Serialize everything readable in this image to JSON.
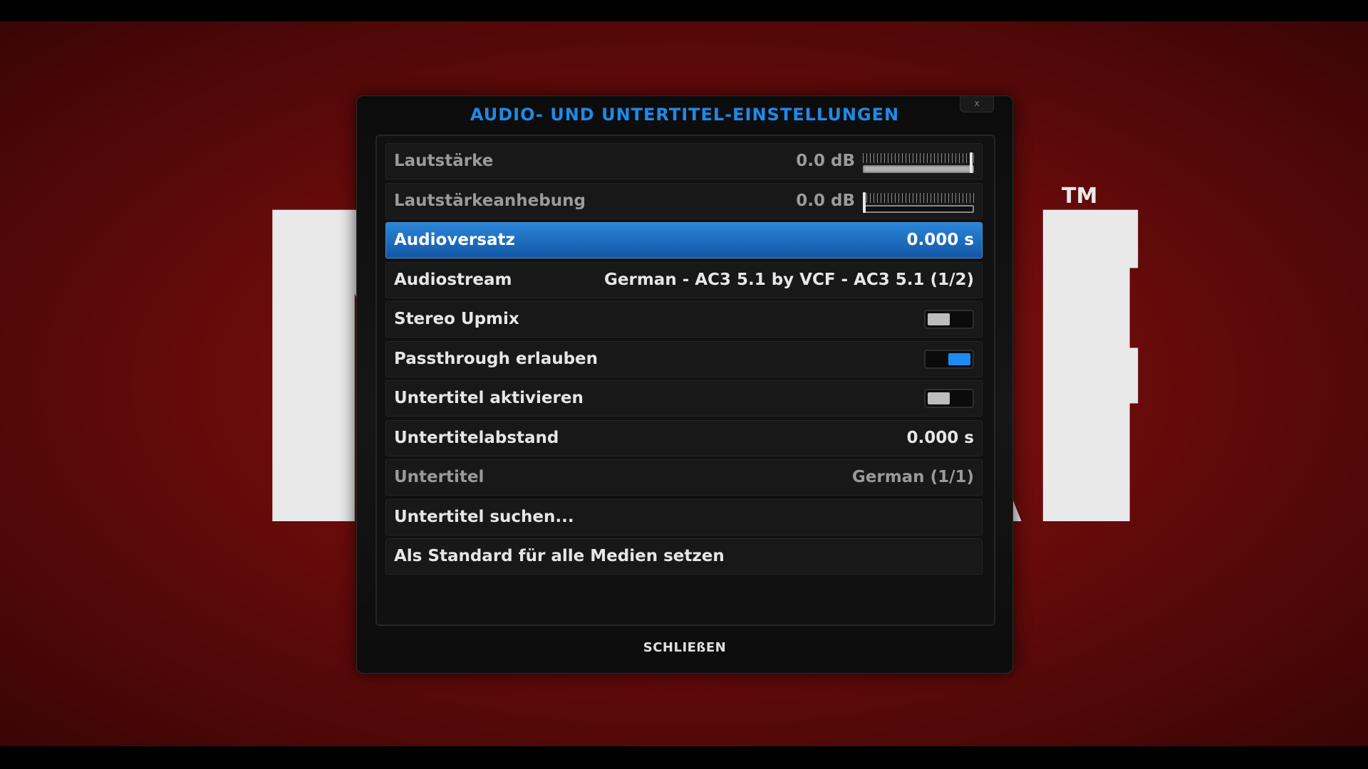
{
  "background": {
    "logo_text": "MARVEL",
    "trademark": "TM"
  },
  "dialog": {
    "title": "AUDIO- UND UNTERTITEL-EINSTELLUNGEN",
    "close_label": "x",
    "footer_button": "SCHLIEßEN",
    "accent_color": "#1f8ae6",
    "focus_color": "#1f6fc4"
  },
  "settings": [
    {
      "label": "Lautstärke",
      "value": "0.0 dB",
      "control": "slider",
      "level": 1.0,
      "state": "dim"
    },
    {
      "label": "Lautstärkeanhebung",
      "value": "0.0 dB",
      "control": "slider",
      "level": 0.0,
      "state": "dim"
    },
    {
      "label": "Audioversatz",
      "value": "0.000 s",
      "control": "value",
      "state": "focused"
    },
    {
      "label": "Audiostream",
      "value": "German - AC3 5.1 by VCF - AC3 5.1 (1/2)",
      "control": "value",
      "state": "normal"
    },
    {
      "label": "Stereo Upmix",
      "control": "toggle",
      "on": false,
      "state": "normal"
    },
    {
      "label": "Passthrough erlauben",
      "control": "toggle",
      "on": true,
      "state": "normal"
    },
    {
      "label": "Untertitel aktivieren",
      "control": "toggle",
      "on": false,
      "state": "normal"
    },
    {
      "label": "Untertitelabstand",
      "value": "0.000 s",
      "control": "value",
      "state": "normal"
    },
    {
      "label": "Untertitel",
      "value": "German (1/1)",
      "control": "value",
      "state": "dim"
    },
    {
      "label": "Untertitel suchen...",
      "control": "button",
      "state": "normal"
    },
    {
      "label": "Als Standard für alle Medien setzen",
      "control": "button",
      "state": "normal"
    }
  ]
}
